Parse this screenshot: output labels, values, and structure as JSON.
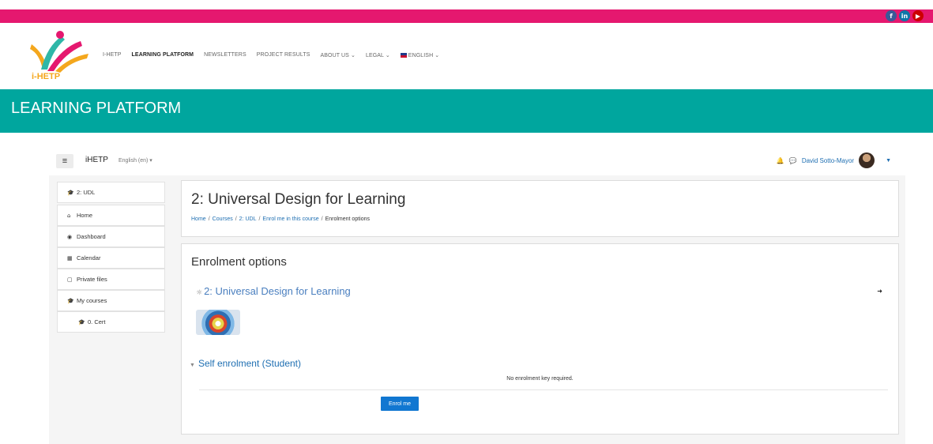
{
  "social": {
    "facebook": "f",
    "linkedin": "in",
    "youtube": "▶"
  },
  "logo": {
    "text": "i-HETP"
  },
  "nav": {
    "items": [
      "I-HETP",
      "LEARNING PLATFORM",
      "NEWSLETTERS",
      "PROJECT RESULTS",
      "ABOUT US ⌄",
      "LEGAL ⌄",
      "ENGLISH ⌄"
    ],
    "active_index": 1
  },
  "banner": {
    "title": "LEARNING PLATFORM"
  },
  "moodle_nav": {
    "menu_icon": "≡",
    "brand": "iHETP",
    "language": "English (en) ▾",
    "user_name": "David Sotto-Mayor"
  },
  "drawer": {
    "items": [
      {
        "icon": "graduation-cap-icon",
        "label": "2: UDL"
      },
      {
        "icon": "home-icon",
        "label": "Home"
      },
      {
        "icon": "dashboard-icon",
        "label": "Dashboard"
      },
      {
        "icon": "calendar-icon",
        "label": "Calendar"
      },
      {
        "icon": "file-icon",
        "label": "Private files"
      },
      {
        "icon": "graduation-cap-icon",
        "label": "My courses"
      },
      {
        "icon": "graduation-cap-icon",
        "label": "0. Cert"
      }
    ]
  },
  "header": {
    "title": "2: Universal Design for Learning",
    "breadcrumb": [
      "Home",
      "Courses",
      "2: UDL",
      "Enrol me in this course",
      "Enrolment options"
    ]
  },
  "enrolment": {
    "heading": "Enrolment options",
    "course_name": "2: Universal Design for Learning",
    "method": "Self enrolment (Student)",
    "note": "No enrolment key required.",
    "button": "Enrol me"
  },
  "colors": {
    "pink": "#e5186f",
    "teal": "#00a69e",
    "link": "#1f6fb2",
    "button": "#1177d1"
  }
}
